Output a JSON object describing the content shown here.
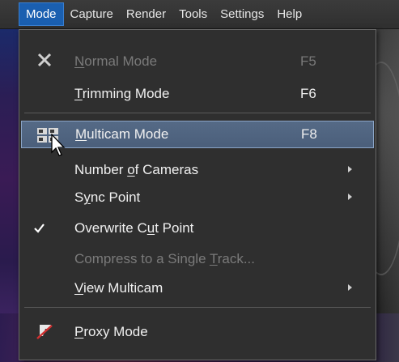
{
  "menubar": {
    "items": [
      {
        "label": "Mode",
        "active": true
      },
      {
        "label": "Capture",
        "active": false
      },
      {
        "label": "Render",
        "active": false
      },
      {
        "label": "Tools",
        "active": false
      },
      {
        "label": "Settings",
        "active": false
      },
      {
        "label": "Help",
        "active": false
      }
    ]
  },
  "mode_menu": {
    "items": [
      {
        "pre": "",
        "u": "N",
        "post": "ormal Mode",
        "shortcut": "F5",
        "icon": "close-x-icon",
        "disabled": true,
        "submenu": false
      },
      {
        "pre": "",
        "u": "T",
        "post": "rimming Mode",
        "shortcut": "F6",
        "icon": "",
        "disabled": false,
        "submenu": false
      },
      {
        "pre": "",
        "u": "M",
        "post": "ulticam Mode",
        "shortcut": "F8",
        "icon": "multicam-icon",
        "disabled": false,
        "submenu": false,
        "highlighted": true
      },
      {
        "pre": "Number ",
        "u": "o",
        "post": "f Cameras",
        "shortcut": "",
        "icon": "",
        "disabled": false,
        "submenu": true
      },
      {
        "pre": "S",
        "u": "y",
        "post": "nc Point",
        "shortcut": "",
        "icon": "",
        "disabled": false,
        "submenu": true
      },
      {
        "pre": "Overwrite C",
        "u": "u",
        "post": "t Point",
        "shortcut": "",
        "icon": "checkmark-icon",
        "disabled": false,
        "submenu": false,
        "checked": true
      },
      {
        "pre": "Compress to a Single ",
        "u": "T",
        "post": "rack...",
        "shortcut": "",
        "icon": "",
        "disabled": true,
        "submenu": false
      },
      {
        "pre": "",
        "u": "V",
        "post": "iew Multicam",
        "shortcut": "",
        "icon": "",
        "disabled": false,
        "submenu": true
      },
      {
        "pre": "",
        "u": "P",
        "post": "roxy Mode",
        "shortcut": "",
        "icon": "proxy-icon",
        "disabled": false,
        "submenu": false
      }
    ]
  },
  "colors": {
    "menubar_active": "#1a5fb0",
    "highlight": "#516682",
    "menu_bg": "#2f2f2f",
    "disabled_text": "#7a7a7a"
  }
}
